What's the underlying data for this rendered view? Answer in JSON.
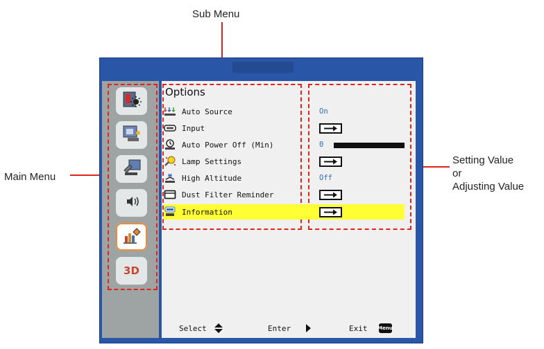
{
  "callouts": {
    "sub_menu": "Sub Menu",
    "main_menu": "Main Menu",
    "setting_line1": "Setting Value",
    "setting_line2": "or",
    "setting_line3": "Adjusting Value"
  },
  "colors": {
    "frame": "#2a56a8",
    "callout": "#e0231b",
    "highlight": "#ffff33",
    "value_text": "#2e6ac4",
    "active_tile_border": "#f08a34"
  },
  "main_menu": {
    "items": [
      {
        "icon": "picture-icon",
        "active": false
      },
      {
        "icon": "display-icon",
        "active": false
      },
      {
        "icon": "setup-icon",
        "active": false
      },
      {
        "icon": "volume-icon",
        "active": false
      },
      {
        "icon": "options-icon",
        "active": true
      },
      {
        "icon": "3d-icon",
        "label": "3D",
        "active": false
      }
    ]
  },
  "sub_menu": {
    "title": "Options",
    "rows": [
      {
        "label": "Auto Source",
        "icon": "auto-source-icon",
        "value": "On",
        "value_type": "text"
      },
      {
        "label": "Input",
        "icon": "input-icon",
        "value_type": "arrow"
      },
      {
        "label": "Auto Power Off (Min)",
        "icon": "power-timer-icon",
        "value": "0",
        "value_type": "slider",
        "level": 0
      },
      {
        "label": "Lamp Settings",
        "icon": "lamp-icon",
        "value_type": "arrow"
      },
      {
        "label": "High Altitude",
        "icon": "altitude-icon",
        "value": "Off",
        "value_type": "text"
      },
      {
        "label": "Dust Filter Reminder",
        "icon": "filter-icon",
        "value_type": "arrow"
      },
      {
        "label": "Information",
        "icon": "info-icon",
        "value_type": "arrow",
        "selected": true
      }
    ]
  },
  "footer": {
    "select": "Select",
    "enter": "Enter",
    "exit": "Exit",
    "menu_badge": "Menu"
  }
}
